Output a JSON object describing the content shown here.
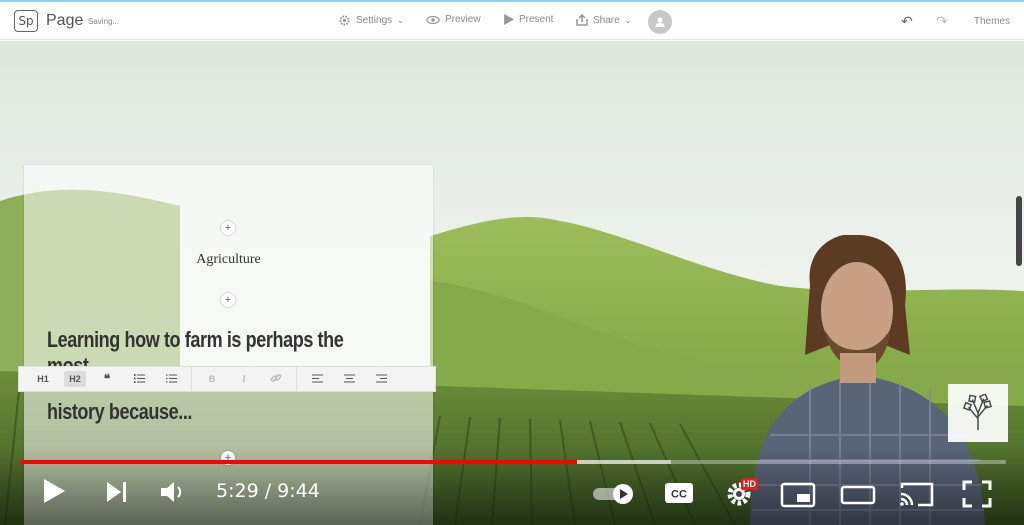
{
  "app": {
    "logo": "Sp",
    "title": "Page",
    "status": "Saving..."
  },
  "toolbar": {
    "settings": "Settings",
    "preview": "Preview",
    "present": "Present",
    "share": "Share",
    "themes": "Themes"
  },
  "editor": {
    "plus": "+",
    "heading": "Agriculture",
    "line1": "Learning how to farm is perhaps the most",
    "line2": "history because..."
  },
  "format_bar": {
    "h1": "H1",
    "h2": "H2",
    "quote": "❝",
    "bold": "B",
    "italic": "I"
  },
  "video": {
    "time": "5:29 / 9:44",
    "hd_badge": "HD",
    "progress_played": 0.565,
    "progress_buffered": 0.66
  },
  "colors": {
    "progress": "#ff0000",
    "accent_line": "#8fd3e8"
  },
  "icons": [
    "gear-icon",
    "eye-icon",
    "play-triangle-icon",
    "share-icon",
    "user-icon",
    "undo-icon",
    "redo-icon",
    "play-icon",
    "next-icon",
    "volume-icon",
    "autoplay-toggle-icon",
    "cc-icon",
    "settings-icon",
    "miniplayer-icon",
    "theater-icon",
    "cast-icon",
    "fullscreen-icon",
    "tree-logo-icon"
  ]
}
